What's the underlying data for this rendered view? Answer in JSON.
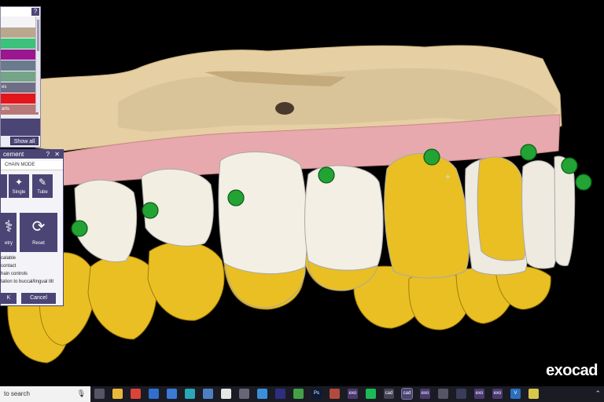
{
  "layer_panel": {
    "help_label": "?",
    "layers": [
      {
        "label": "",
        "color": "#f4f3f6"
      },
      {
        "label": "",
        "color": "#b9a88e"
      },
      {
        "label": "",
        "color": "#3cc27a"
      },
      {
        "label": "",
        "color": "#9b168f"
      },
      {
        "label": "",
        "color": "#6b7b8f"
      },
      {
        "label": "",
        "color": "#76a488"
      },
      {
        "label": "es",
        "color": "#6e6e86"
      },
      {
        "label": "",
        "color": "#e3161c"
      },
      {
        "label": "arts",
        "color": "#b77877"
      },
      {
        "label": "shes",
        "color": "#1c32c8"
      },
      {
        "label": "ttom",
        "color": "#6f88b5"
      }
    ],
    "show_all_label": "Show all"
  },
  "placement_dialog": {
    "title": "cement",
    "title_controls": "? ✕",
    "mode_header": "CHAIN MODE",
    "mode_buttons": [
      {
        "label": "",
        "glyph": ""
      },
      {
        "label": "Single",
        "glyph": "✦"
      },
      {
        "label": "Tube",
        "glyph": "✎"
      }
    ],
    "action_buttons": [
      {
        "label": "etry",
        "glyph": "⚕"
      },
      {
        "label": "Reset",
        "glyph": "⟳"
      }
    ],
    "options": [
      "calable",
      "contact",
      "hain controls",
      "tation to buccal/lingual tilt"
    ],
    "ok_label": "K",
    "cancel_label": "Cancel"
  },
  "brand": "exocad",
  "taskbar": {
    "search_placeholder": "to search",
    "mic_icon": "mic-icon",
    "apps": [
      {
        "name": "task-view",
        "color": "#555566",
        "text": ""
      },
      {
        "name": "file-explorer",
        "color": "#e9b83a",
        "text": ""
      },
      {
        "name": "chrome",
        "color": "#db4437",
        "text": ""
      },
      {
        "name": "app-circle",
        "color": "#2f6fd0",
        "text": ""
      },
      {
        "name": "app-monitor",
        "color": "#3a7bd5",
        "text": ""
      },
      {
        "name": "app-shield",
        "color": "#2aa6b8",
        "text": ""
      },
      {
        "name": "app-photo",
        "color": "#4d7fc4",
        "text": ""
      },
      {
        "name": "app-clock",
        "color": "#e6e6e6",
        "text": ""
      },
      {
        "name": "calculator",
        "color": "#666677",
        "text": ""
      },
      {
        "name": "app-grid",
        "color": "#3b8fd9",
        "text": ""
      },
      {
        "name": "app-search",
        "color": "#2e2e80",
        "text": ""
      },
      {
        "name": "app-green",
        "color": "#43a047",
        "text": ""
      },
      {
        "name": "photoshop",
        "color": "#0c1a38",
        "text": "Ps"
      },
      {
        "name": "app-gem",
        "color": "#b24b3c",
        "text": ""
      },
      {
        "name": "exo-app-1",
        "color": "#4b3a70",
        "text": "exo"
      },
      {
        "name": "spotify",
        "color": "#1db954",
        "text": ""
      },
      {
        "name": "cad-app-1",
        "color": "#444455",
        "text": "cad"
      },
      {
        "name": "cad-app-2",
        "color": "#4b4576",
        "text": "cad"
      },
      {
        "name": "exo-app-2",
        "color": "#4b3a70",
        "text": "exo"
      },
      {
        "name": "app-gear",
        "color": "#555566",
        "text": ""
      },
      {
        "name": "app-moon",
        "color": "#3b3b5a",
        "text": ""
      },
      {
        "name": "exo-app-3",
        "color": "#4b3a70",
        "text": "exo"
      },
      {
        "name": "exo-app-4",
        "color": "#4b3a70",
        "text": "exo"
      },
      {
        "name": "app-v",
        "color": "#2a6fbd",
        "text": "V"
      },
      {
        "name": "app-notes",
        "color": "#d8c84a",
        "text": ""
      }
    ],
    "tray_text": "⌃"
  }
}
